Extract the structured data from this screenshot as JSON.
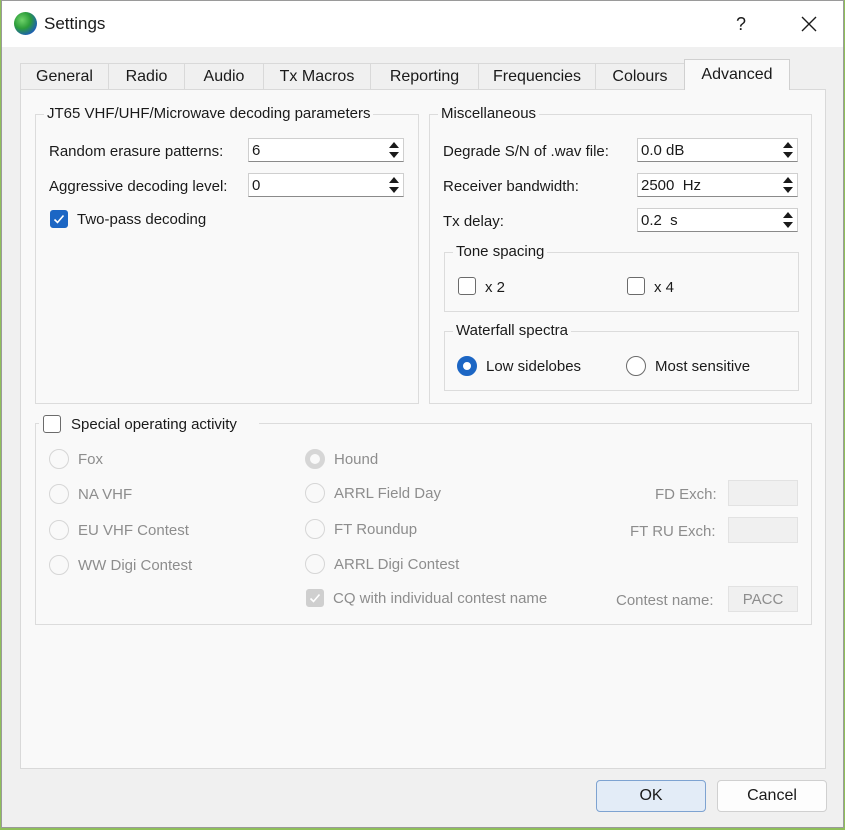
{
  "window": {
    "title": "Settings",
    "help": "?"
  },
  "tabs": [
    {
      "label": "General"
    },
    {
      "label": "Radio"
    },
    {
      "label": "Audio"
    },
    {
      "label": "Tx Macros"
    },
    {
      "label": "Reporting"
    },
    {
      "label": "Frequencies"
    },
    {
      "label": "Colours"
    },
    {
      "label": "Advanced",
      "active": true
    }
  ],
  "jt65": {
    "title": "JT65 VHF/UHF/Microwave decoding parameters",
    "random_erasure_label": "Random erasure patterns:",
    "random_erasure_value": "6",
    "aggressive_label": "Aggressive decoding level:",
    "aggressive_value": "0",
    "two_pass_label": "Two-pass decoding",
    "two_pass_checked": true
  },
  "misc": {
    "title": "Miscellaneous",
    "degrade_label": "Degrade S/N of .wav file:",
    "degrade_value": "0.0 dB",
    "bandwidth_label": "Receiver bandwidth:",
    "bandwidth_value": "2500  Hz",
    "txdelay_label": "Tx delay:",
    "txdelay_value": "0.2  s",
    "tone_spacing": {
      "title": "Tone spacing",
      "x2": "x 2",
      "x4": "x 4"
    },
    "waterfall": {
      "title": "Waterfall spectra",
      "low": "Low sidelobes",
      "most": "Most sensitive",
      "selected": "Low sidelobes"
    }
  },
  "special": {
    "title": "Special operating activity",
    "options_col1": [
      "Fox",
      "NA VHF",
      "EU VHF Contest",
      "WW Digi Contest"
    ],
    "options_col2": [
      "Hound",
      "ARRL Field Day",
      "FT Roundup",
      "ARRL Digi Contest"
    ],
    "selected": "Hound",
    "cq_label": "CQ with individual contest name",
    "fd_exch_label": "FD Exch:",
    "ft_ru_exch_label": "FT RU Exch:",
    "contest_name_label": "Contest name:",
    "contest_name_value": "PACC"
  },
  "buttons": {
    "ok": "OK",
    "cancel": "Cancel"
  },
  "colors": {
    "accent": "#1c66c4",
    "background": "#f0f0f0",
    "panel": "#f9f9f9"
  }
}
